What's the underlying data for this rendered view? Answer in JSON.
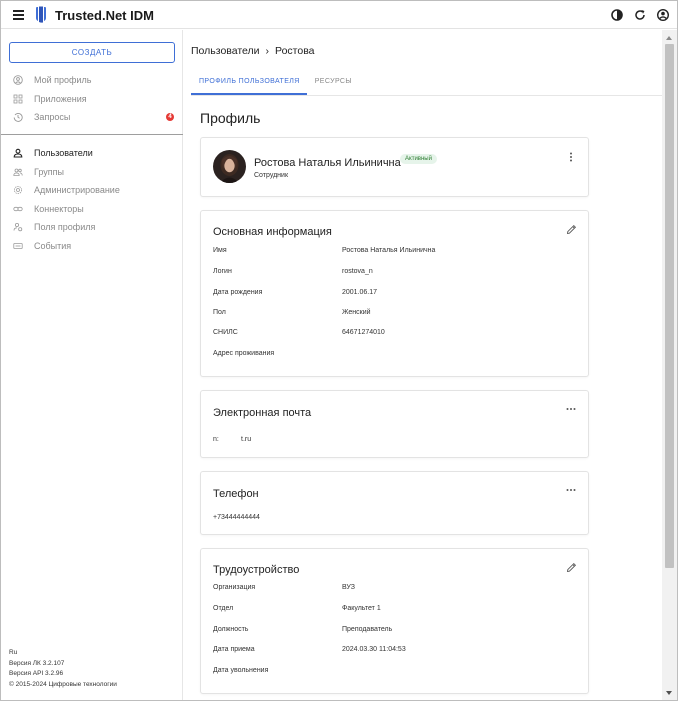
{
  "app": {
    "title": "Trusted.Net IDM"
  },
  "sidebar": {
    "create_label": "СОЗДАТЬ",
    "top_items": [
      {
        "label": "Мой профиль",
        "icon": "user-circle-icon"
      },
      {
        "label": "Приложения",
        "icon": "grid-icon"
      },
      {
        "label": "Запросы",
        "icon": "history-icon",
        "badge": "4"
      }
    ],
    "admin_items": [
      {
        "label": "Пользователи",
        "icon": "user-icon"
      },
      {
        "label": "Группы",
        "icon": "group-icon"
      },
      {
        "label": "Администрирование",
        "icon": "gear-icon"
      },
      {
        "label": "Коннекторы",
        "icon": "link-icon"
      },
      {
        "label": "Поля профиля",
        "icon": "fields-icon"
      },
      {
        "label": "События",
        "icon": "list-icon"
      }
    ],
    "footer": {
      "lang": "Ru",
      "lk_version": "Версия ЛК 3.2.107",
      "api_version": "Версия API 3.2.96",
      "copyright": "© 2015-2024 Цифровые технологии"
    }
  },
  "breadcrumb": {
    "parent": "Пользователи",
    "separator": "›",
    "current": "Ростова"
  },
  "tabs": [
    "ПРОФИЛЬ ПОЛЬЗОВАТЕЛЯ",
    "РЕСУРСЫ"
  ],
  "page_title": "Профиль",
  "profile_card": {
    "name": "Ростова Наталья Ильинична",
    "role": "Сотрудник",
    "status": "Активный"
  },
  "basic_info": {
    "title": "Основная информация",
    "rows": [
      {
        "label": "Имя",
        "value": "Ростова Наталья Ильинична"
      },
      {
        "label": "Логин",
        "value": "rostova_n"
      },
      {
        "label": "Дата рождения",
        "value": "2001.06.17"
      },
      {
        "label": "Пол",
        "value": "Женский"
      },
      {
        "label": "СНИЛС",
        "value": "64671274010"
      },
      {
        "label": "Адрес проживания",
        "value": ""
      }
    ]
  },
  "email": {
    "title": "Электронная почта",
    "value_a": "n:",
    "value_b": "t.ru"
  },
  "phone": {
    "title": "Телефон",
    "value": "+73444444444"
  },
  "employment": {
    "title": "Трудоустройство",
    "rows": [
      {
        "label": "Организация",
        "value": "ВУЗ"
      },
      {
        "label": "Отдел",
        "value": "Факультет 1"
      },
      {
        "label": "Должность",
        "value": "Преподаватель"
      },
      {
        "label": "Дата приема",
        "value": "2024.03.30 11:04:53"
      },
      {
        "label": "Дата увольнения",
        "value": ""
      }
    ]
  },
  "colors": {
    "accent": "#3f6fd6",
    "badge": "#e53935",
    "status_bg": "#e6f4ea",
    "status_text": "#2e7d32"
  }
}
